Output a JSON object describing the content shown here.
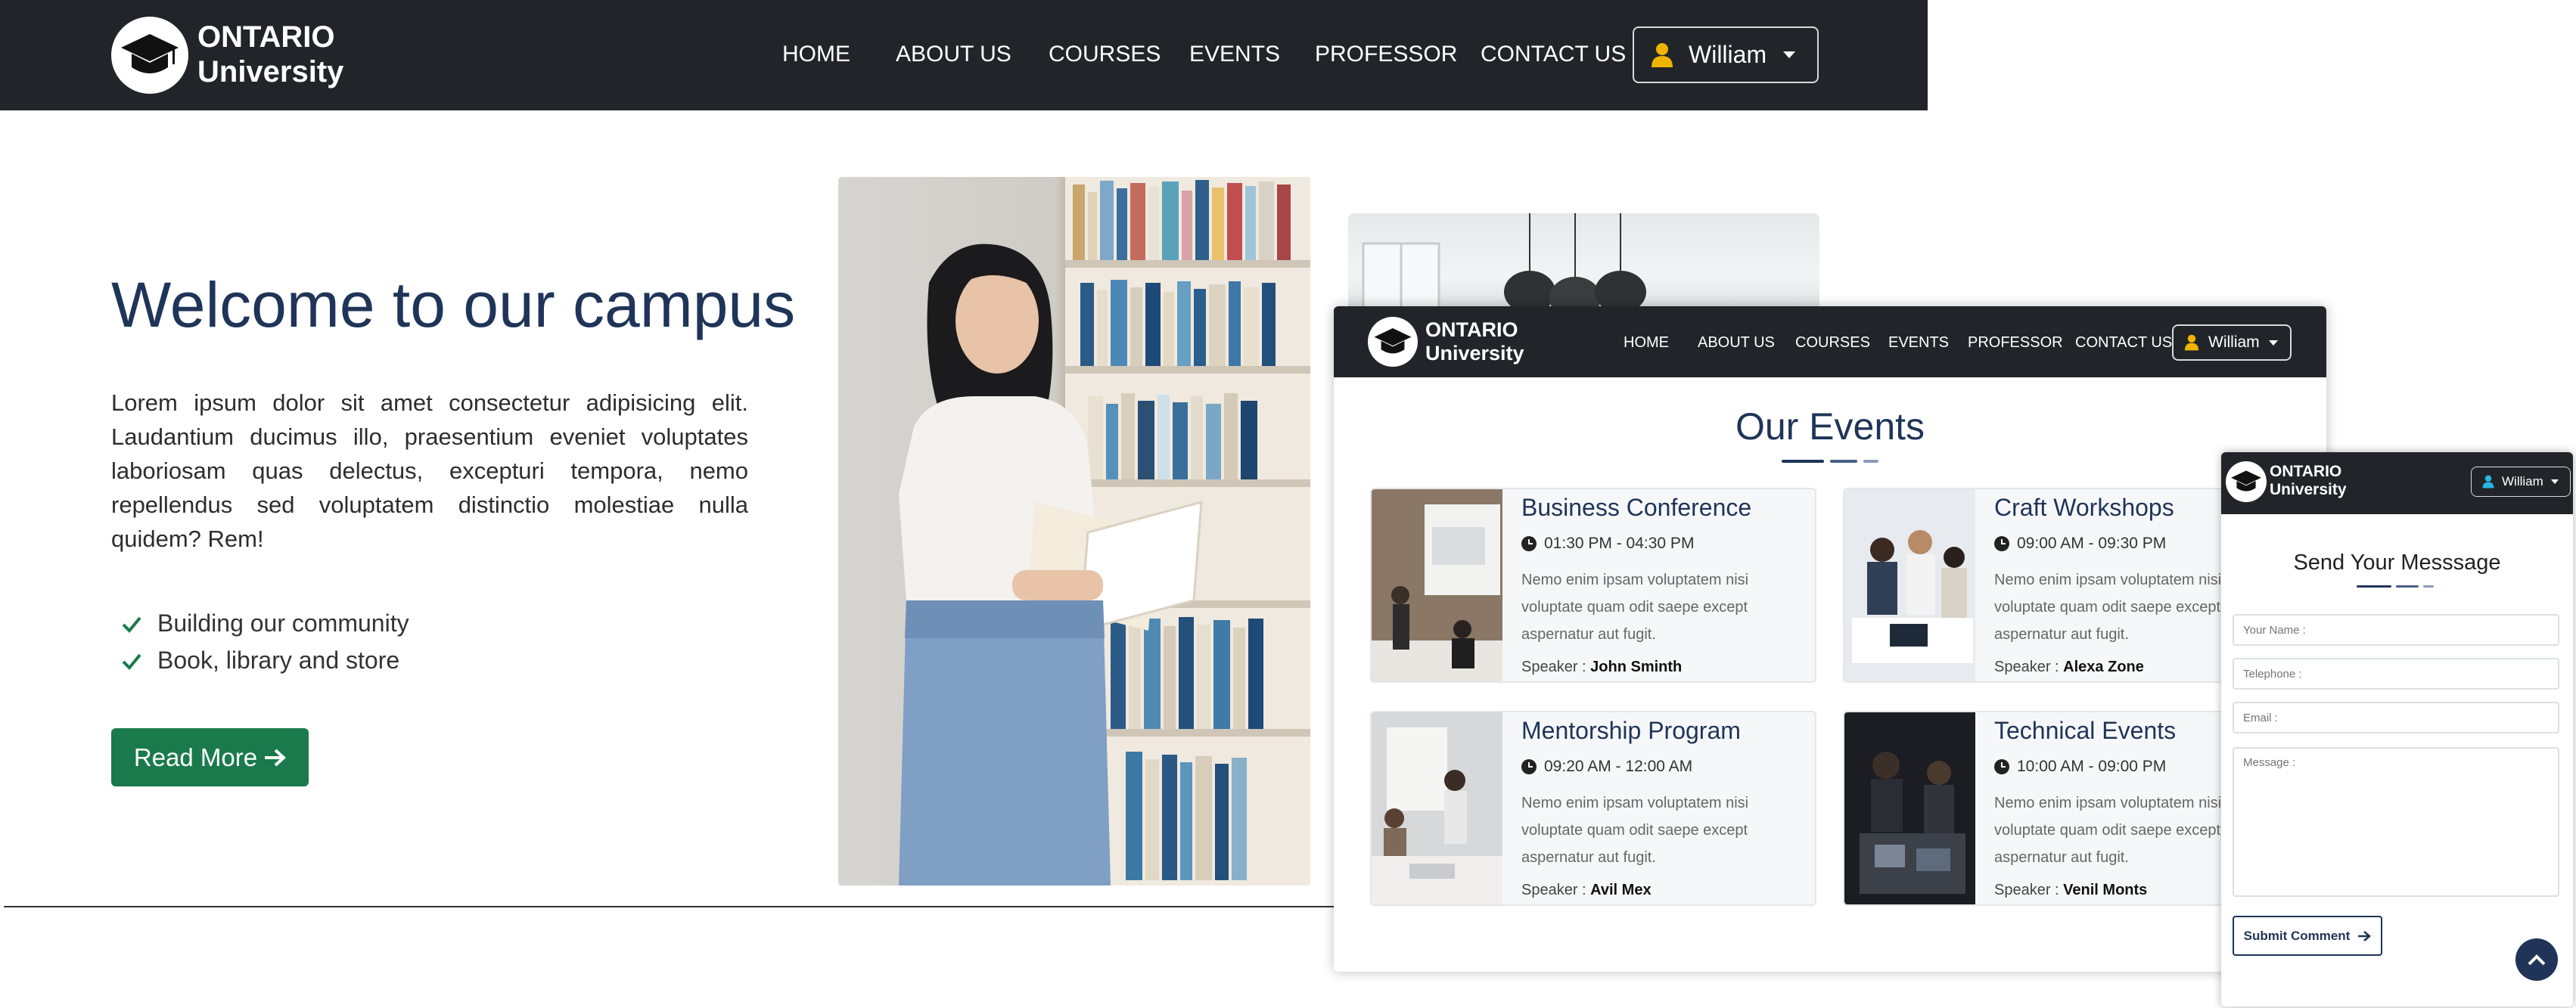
{
  "brand": {
    "line1": "ONTARIO",
    "line2": "University"
  },
  "nav": {
    "items": [
      "HOME",
      "ABOUT US",
      "COURSES",
      "EVENTS",
      "PROFESSOR",
      "CONTACT US"
    ],
    "user": "William"
  },
  "hero": {
    "title": "Welcome to our campus",
    "text": "Lorem ipsum dolor sit amet consectetur adipisicing elit. Laudantium ducimus illo, praesentium eveniet voluptates laboriosam quas delectus, excepturi tempora, nemo repellendus sed voluptatem distinctio molestiae nulla quidem? Rem!",
    "features": [
      "Building our community",
      "Book, library and store"
    ],
    "button": "Read More"
  },
  "events": {
    "title": "Our Events",
    "speaker_label": "Speaker :",
    "items": [
      {
        "title": "Business Conference",
        "time": "01:30 PM - 04:30 PM",
        "desc": "Nemo enim ipsam voluptatem nisi voluptate quam odit saepe except aspernatur aut fugit.",
        "speaker": "John Sminth"
      },
      {
        "title": "Craft Workshops",
        "time": "09:00 AM - 09:30 PM",
        "desc": "Nemo enim ipsam voluptatem nisi voluptate quam odit saepe except aspernatur aut fugit.",
        "speaker": "Alexa Zone"
      },
      {
        "title": "Mentorship Program",
        "time": "09:20 AM - 12:00 AM",
        "desc": "Nemo enim ipsam voluptatem nisi voluptate quam odit saepe except aspernatur aut fugit.",
        "speaker": "Avil Mex"
      },
      {
        "title": "Technical Events",
        "time": "10:00 AM - 09:00 PM",
        "desc": "Nemo enim ipsam voluptatem nisi voluptate quam odit saepe except aspernatur aut fugit.",
        "speaker": "Venil Monts"
      }
    ]
  },
  "contact": {
    "title": "Send Your Messsage",
    "name_placeholder": "Your Name :",
    "phone_placeholder": "Telephone :",
    "email_placeholder": "Email :",
    "message_placeholder": "Message :",
    "submit": "Submit Comment"
  },
  "colors": {
    "navbar": "#212529",
    "primary_navy": "#1f3458",
    "success_green": "#1a7a4c",
    "accent_gold": "#f0b400",
    "accent_cyan": "#2bb3e6"
  }
}
